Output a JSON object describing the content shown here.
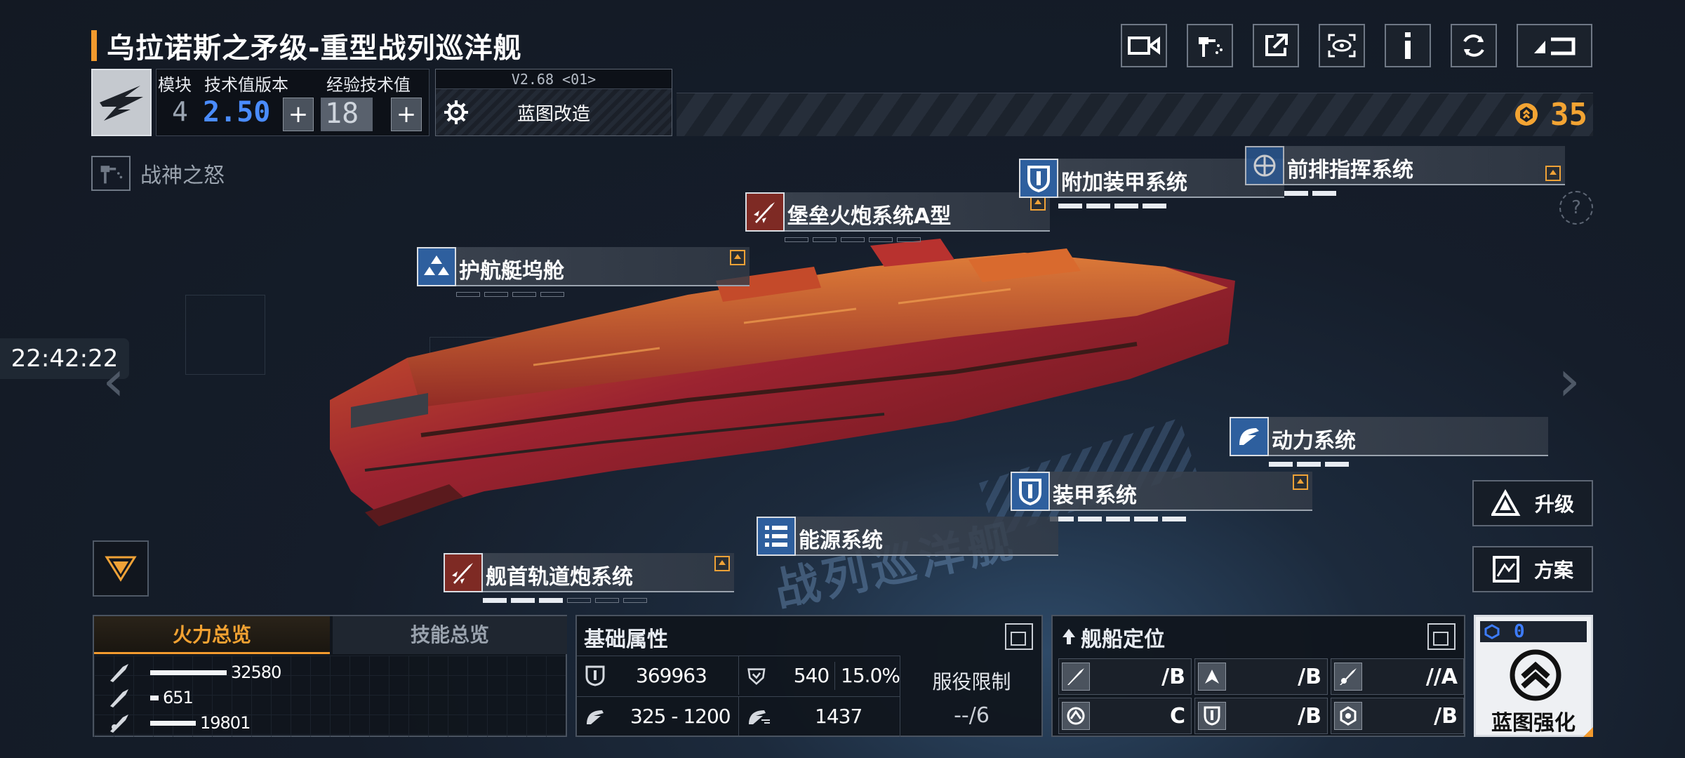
{
  "header": {
    "title": "乌拉诺斯之矛级-重型战列巡洋舰",
    "module_label": "模块",
    "module_value": "4",
    "tech_label": "技术值版本",
    "tech_value": "2.50",
    "exp_label": "经验技术值",
    "exp_value": "18",
    "blueprint_version": "V2.68 <01>",
    "blueprint_mod_label": "蓝图改造",
    "currency_value": "35",
    "mode_label": "战神之怒"
  },
  "toolbar": {
    "icons": [
      "video-camera-icon",
      "paint-icon",
      "share-icon",
      "view-icon",
      "info-icon",
      "refresh-icon",
      "back-icon"
    ]
  },
  "clock": "22:42:22",
  "modules": {
    "escort_dock": "护航艇坞舱",
    "fortress_cannon": "堡垒火炮系统A型",
    "extra_armor": "附加装甲系统",
    "front_command": "前排指挥系统",
    "power": "动力系统",
    "armor": "装甲系统",
    "energy": "能源系统",
    "bow_railgun": "舰首轨道炮系统"
  },
  "side_buttons": {
    "upgrade": "升级",
    "plan": "方案"
  },
  "watermark": "战列巡洋舰",
  "fire_panel": {
    "tab_fire": "火力总览",
    "tab_skill": "技能总览",
    "rows": [
      {
        "value": "32580",
        "fraction": 0.84
      },
      {
        "value": "651",
        "fraction": 0.09
      },
      {
        "value": "19801",
        "fraction": 0.5
      }
    ]
  },
  "attr_panel": {
    "title": "基础属性",
    "hp": "369963",
    "armor": "540",
    "armor_pct": "15.0%",
    "speed": "325 - 1200",
    "warp": "1437",
    "service_label": "服役限制",
    "service_value": "--/6"
  },
  "role_panel": {
    "title": "舰船定位",
    "grades": [
      "/B",
      "/B",
      "//A",
      "C",
      "/B",
      "/B"
    ]
  },
  "enhance": {
    "count": "0",
    "label": "蓝图强化"
  },
  "colors": {
    "accent": "#f29a2e",
    "module_blue": "#2e5f9e",
    "module_red": "#7e2a24",
    "tech_blue": "#4a8cff"
  }
}
